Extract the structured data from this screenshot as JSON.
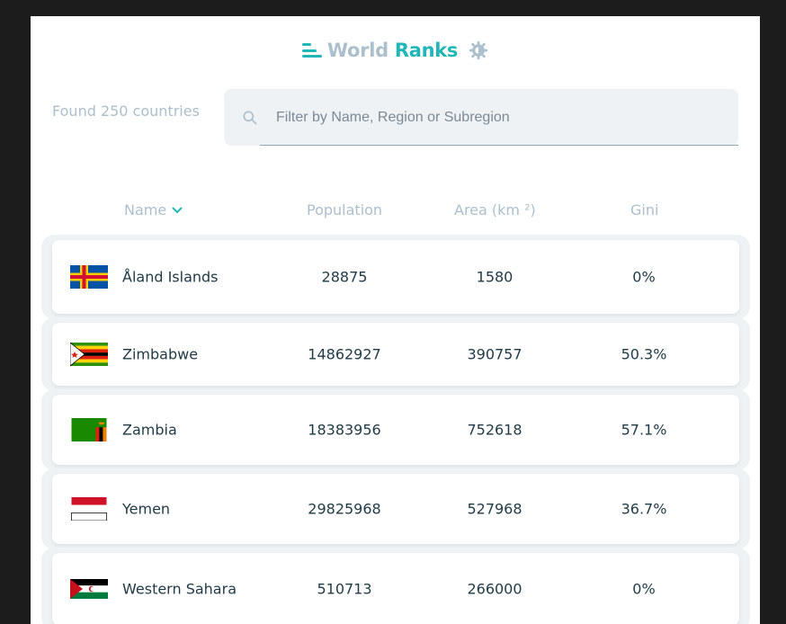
{
  "header": {
    "title_part1": "World",
    "title_part2": "Ranks",
    "icons": [
      "bar-chart-icon",
      "sun-icon"
    ]
  },
  "search": {
    "count_text": "Found 250 countries",
    "placeholder": "Filter by Name, Region or Subregion",
    "value": ""
  },
  "table": {
    "columns": [
      "Name",
      "Population",
      "Area (km ²)",
      "Gini"
    ],
    "sort_icon": "chevron-down-icon",
    "rows": [
      {
        "name": "Åland Islands",
        "population": "28875",
        "area": "1580",
        "gini": "0%",
        "flag": "aland-flag-icon"
      },
      {
        "name": "Zimbabwe",
        "population": "14862927",
        "area": "390757",
        "gini": "50.3%",
        "flag": "zimbabwe-flag-icon"
      },
      {
        "name": "Zambia",
        "population": "18383956",
        "area": "752618",
        "gini": "57.1%",
        "flag": "zambia-flag-icon"
      },
      {
        "name": "Yemen",
        "population": "29825968",
        "area": "527968",
        "gini": "36.7%",
        "flag": "yemen-flag-icon"
      },
      {
        "name": "Western Sahara",
        "population": "510713",
        "area": "266000",
        "gini": "0%",
        "flag": "western-sahara-flag-icon"
      }
    ]
  },
  "colors": {
    "accent": "#21b6b7",
    "muted": "#acbfcc",
    "text": "#1f3a46"
  }
}
